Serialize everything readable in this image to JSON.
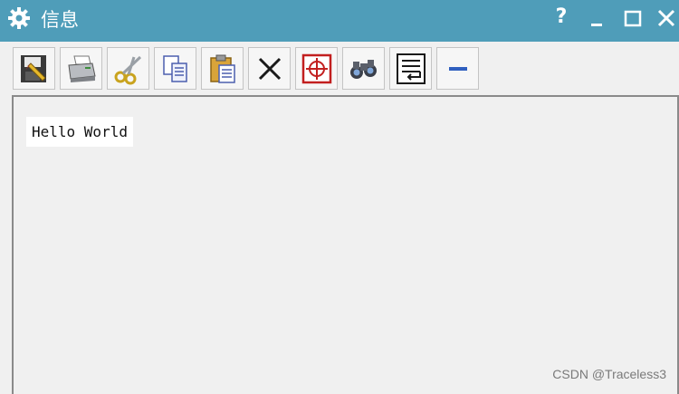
{
  "window": {
    "title": "信息",
    "icons": {
      "app": "gear-icon",
      "help": "?",
      "minimize": "minimize-icon",
      "maximize": "maximize-icon",
      "close": "close-icon"
    }
  },
  "toolbar": {
    "buttons": [
      {
        "name": "save-button",
        "icon": "save-icon"
      },
      {
        "name": "print-button",
        "icon": "printer-icon"
      },
      {
        "name": "cut-button",
        "icon": "scissors-icon"
      },
      {
        "name": "copy-button",
        "icon": "copy-icon"
      },
      {
        "name": "paste-button",
        "icon": "paste-icon"
      },
      {
        "name": "delete-button",
        "icon": "x-icon"
      },
      {
        "name": "target-button",
        "icon": "crosshair-icon"
      },
      {
        "name": "find-button",
        "icon": "binoculars-icon"
      },
      {
        "name": "wrap-button",
        "icon": "word-wrap-icon"
      },
      {
        "name": "collapse-button",
        "icon": "minus-icon"
      }
    ]
  },
  "content": {
    "text": "Hello World"
  },
  "watermark": "CSDN @Traceless3",
  "colors": {
    "titlebar": "#4f9db9",
    "background": "#f0f0f0",
    "accent_blue": "#2f5fbf",
    "target_red": "#c21f1f"
  }
}
